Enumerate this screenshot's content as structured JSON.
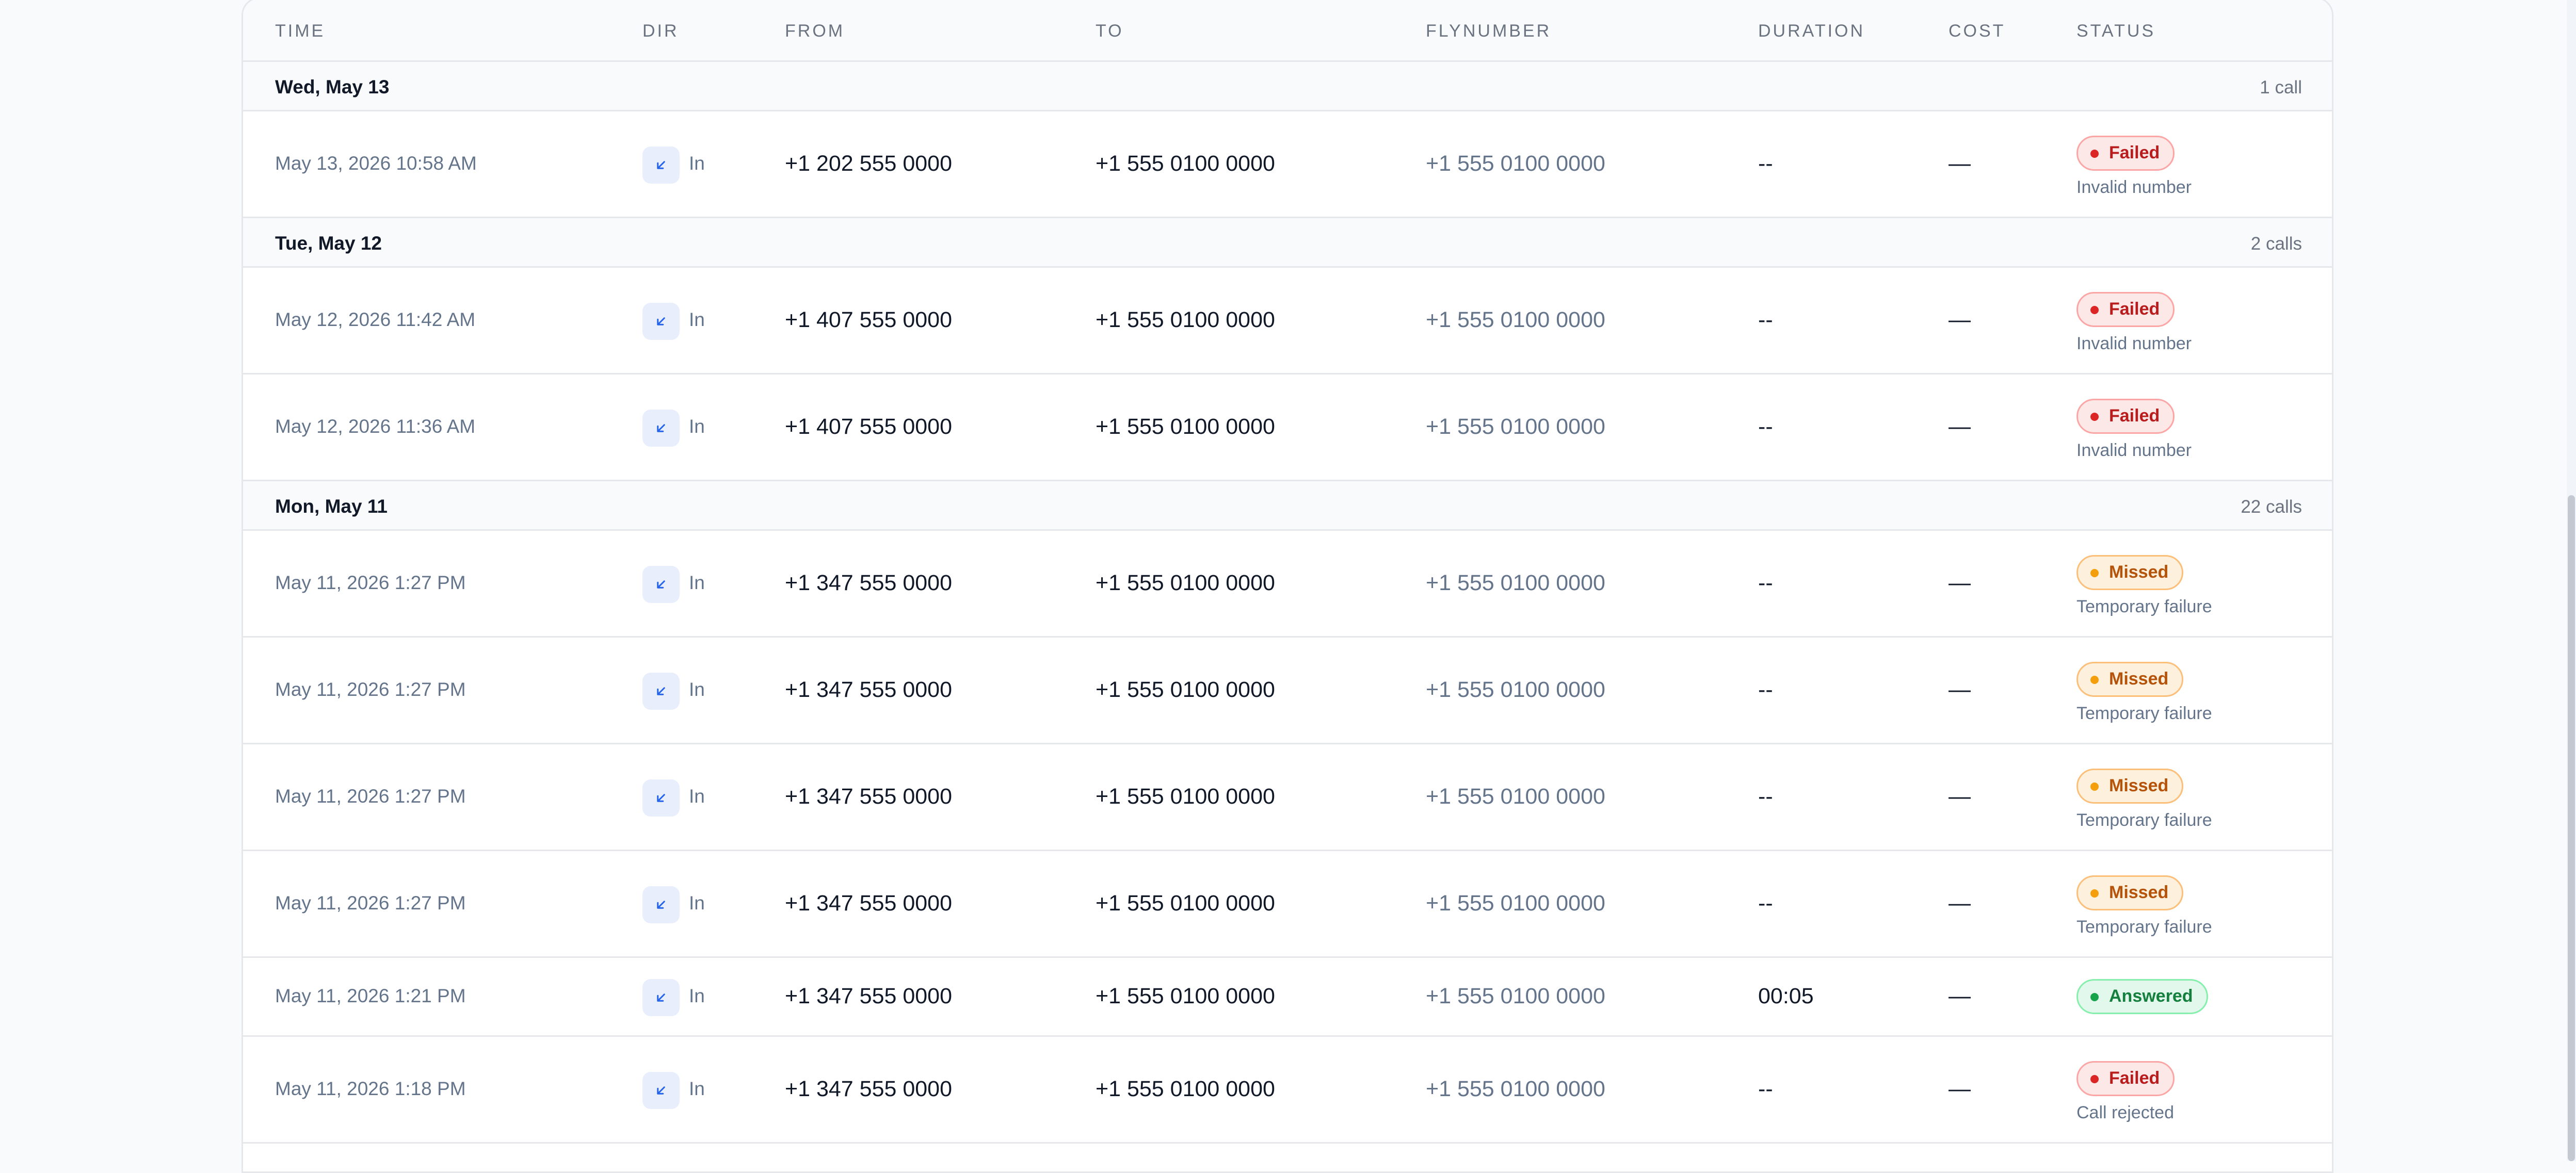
{
  "columns": {
    "time": "TIME",
    "dir": "DIR",
    "from": "FROM",
    "to": "TO",
    "flynumber": "FLYNUMBER",
    "duration": "DURATION",
    "cost": "COST",
    "status": "STATUS"
  },
  "groups": [
    {
      "label": "Wed, May 13",
      "count": "1 call"
    },
    {
      "label": "Tue, May 12",
      "count": "2 calls"
    },
    {
      "label": "Mon, May 11",
      "count": "22 calls"
    }
  ],
  "rows": [
    {
      "time": "May 13, 2026 10:58 AM",
      "dir": "In",
      "from": "+1 202 555 0000",
      "to": "+1 555 0100 0000",
      "flynumber": "+1 555 0100 0000",
      "duration": "--",
      "cost": "—",
      "status": "Failed",
      "reason": "Invalid number"
    },
    {
      "time": "May 12, 2026 11:42 AM",
      "dir": "In",
      "from": "+1 407 555 0000",
      "to": "+1 555 0100 0000",
      "flynumber": "+1 555 0100 0000",
      "duration": "--",
      "cost": "—",
      "status": "Failed",
      "reason": "Invalid number"
    },
    {
      "time": "May 12, 2026 11:36 AM",
      "dir": "In",
      "from": "+1 407 555 0000",
      "to": "+1 555 0100 0000",
      "flynumber": "+1 555 0100 0000",
      "duration": "--",
      "cost": "—",
      "status": "Failed",
      "reason": "Invalid number"
    },
    {
      "time": "May 11, 2026 1:27 PM",
      "dir": "In",
      "from": "+1 347 555 0000",
      "to": "+1 555 0100 0000",
      "flynumber": "+1 555 0100 0000",
      "duration": "--",
      "cost": "—",
      "status": "Missed",
      "reason": "Temporary failure"
    },
    {
      "time": "May 11, 2026 1:27 PM",
      "dir": "In",
      "from": "+1 347 555 0000",
      "to": "+1 555 0100 0000",
      "flynumber": "+1 555 0100 0000",
      "duration": "--",
      "cost": "—",
      "status": "Missed",
      "reason": "Temporary failure"
    },
    {
      "time": "May 11, 2026 1:27 PM",
      "dir": "In",
      "from": "+1 347 555 0000",
      "to": "+1 555 0100 0000",
      "flynumber": "+1 555 0100 0000",
      "duration": "--",
      "cost": "—",
      "status": "Missed",
      "reason": "Temporary failure"
    },
    {
      "time": "May 11, 2026 1:27 PM",
      "dir": "In",
      "from": "+1 347 555 0000",
      "to": "+1 555 0100 0000",
      "flynumber": "+1 555 0100 0000",
      "duration": "--",
      "cost": "—",
      "status": "Missed",
      "reason": "Temporary failure"
    },
    {
      "time": "May 11, 2026 1:21 PM",
      "dir": "In",
      "from": "+1 347 555 0000",
      "to": "+1 555 0100 0000",
      "flynumber": "+1 555 0100 0000",
      "duration": "00:05",
      "cost": "—",
      "status": "Answered",
      "reason": ""
    },
    {
      "time": "May 11, 2026 1:18 PM",
      "dir": "In",
      "from": "+1 347 555 0000",
      "to": "+1 555 0100 0000",
      "flynumber": "+1 555 0100 0000",
      "duration": "--",
      "cost": "—",
      "status": "Failed",
      "reason": "Call rejected"
    }
  ],
  "icons": {
    "direction": "arrow-down-left-icon"
  },
  "colors": {
    "failed": "#dc2626",
    "missed": "#f59e0b",
    "answered": "#16a34a",
    "accent": "#2563eb"
  }
}
